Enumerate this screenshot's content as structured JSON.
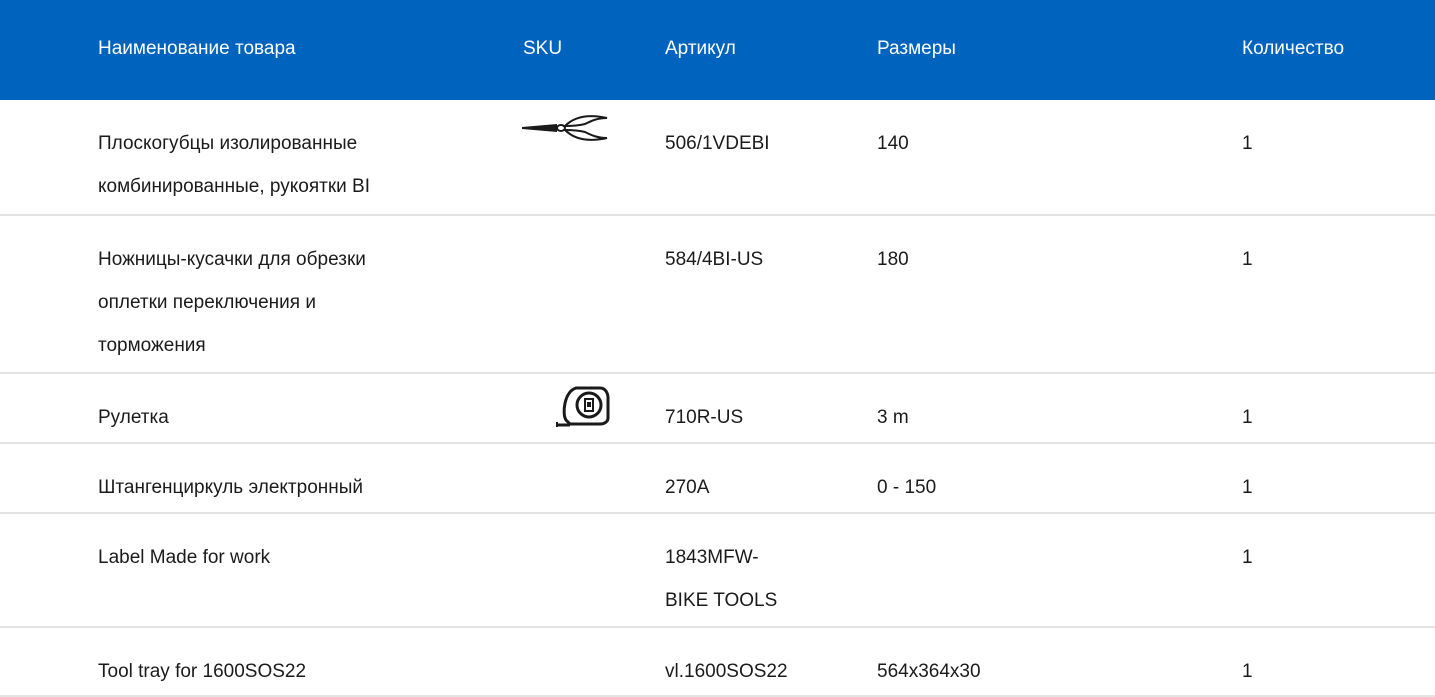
{
  "header": {
    "name": "Наименование товара",
    "sku": "SKU",
    "article": "Артикул",
    "size": "Размеры",
    "quantity": "Количество"
  },
  "colors": {
    "header_bg": "#0063be",
    "header_text": "#ffffff",
    "row_divider": "#e3e3e3",
    "text": "#1b1b1b"
  },
  "rows": [
    {
      "name_lines": [
        "Плоскогубцы изолированные",
        "комбинированные, рукоятки BI"
      ],
      "sku_icon": "pliers-icon",
      "article_lines": [
        "506/1VDEBI"
      ],
      "size": "140",
      "quantity": "1"
    },
    {
      "name_lines": [
        "Ножницы-кусачки для обрезки",
        "оплетки переключения и",
        "торможения"
      ],
      "sku_icon": "",
      "article_lines": [
        "584/4BI-US"
      ],
      "size": "180",
      "quantity": "1"
    },
    {
      "name_lines": [
        "Рулетка"
      ],
      "sku_icon": "tape-measure-icon",
      "article_lines": [
        "710R-US"
      ],
      "size": "3 m",
      "quantity": "1"
    },
    {
      "name_lines": [
        "Штангенциркуль электронный"
      ],
      "sku_icon": "",
      "article_lines": [
        "270A"
      ],
      "size": "0 - 150",
      "quantity": "1"
    },
    {
      "name_lines": [
        "Label Made for work"
      ],
      "sku_icon": "",
      "article_lines": [
        "1843MFW-",
        "BIKE TOOLS"
      ],
      "size": "",
      "quantity": "1"
    },
    {
      "name_lines": [
        "Tool tray for 1600SOS22"
      ],
      "sku_icon": "",
      "article_lines": [
        "vl.1600SOS22"
      ],
      "size": "564x364x30",
      "quantity": "1"
    }
  ]
}
